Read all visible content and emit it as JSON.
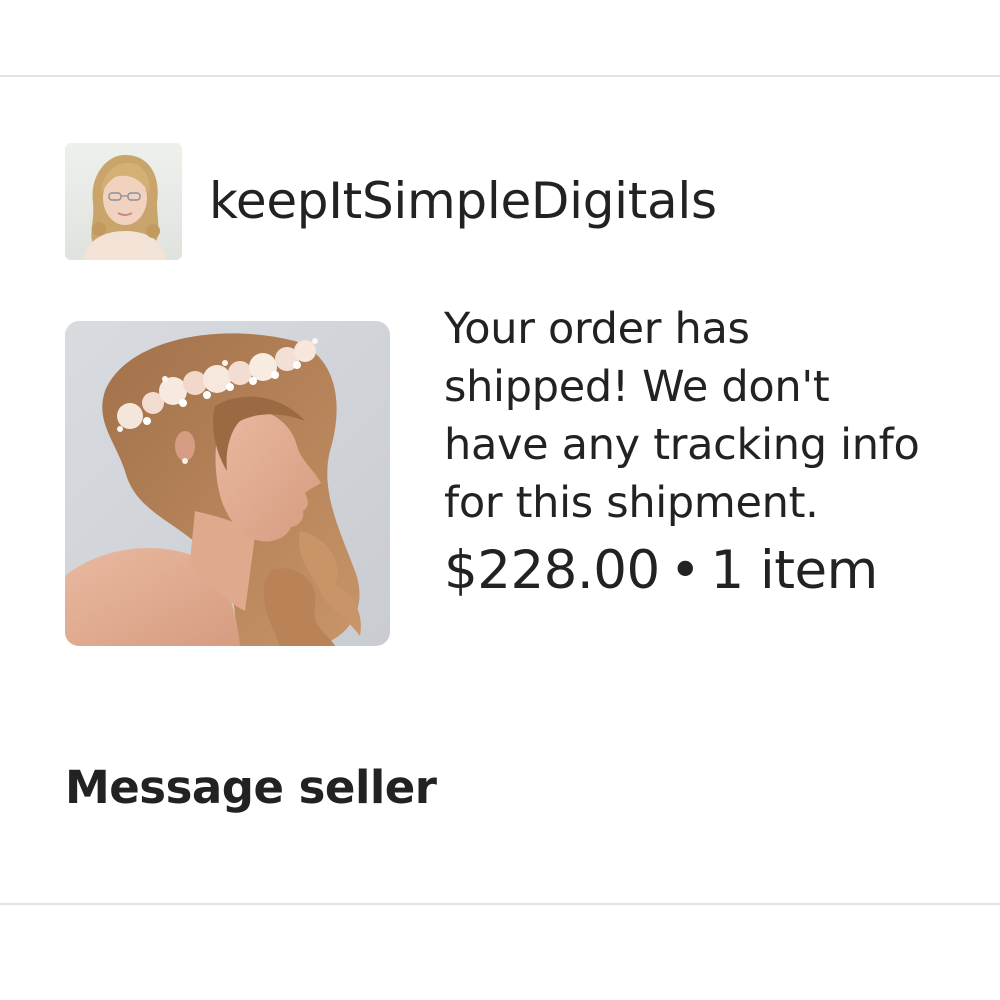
{
  "shop": {
    "name": "keepItSimpleDigitals",
    "avatar_icon": "seller-avatar-photo"
  },
  "order": {
    "product_image_icon": "floral-headpiece-product-photo",
    "status_text": "Your order has shipped! We don't have any tracking info for this shipment.",
    "price": "$228.00",
    "separator": "•",
    "item_count": "1 item"
  },
  "actions": {
    "message_seller_label": "Message seller"
  },
  "colors": {
    "text": "#222222",
    "divider": "#e3e3e3",
    "background": "#ffffff"
  }
}
